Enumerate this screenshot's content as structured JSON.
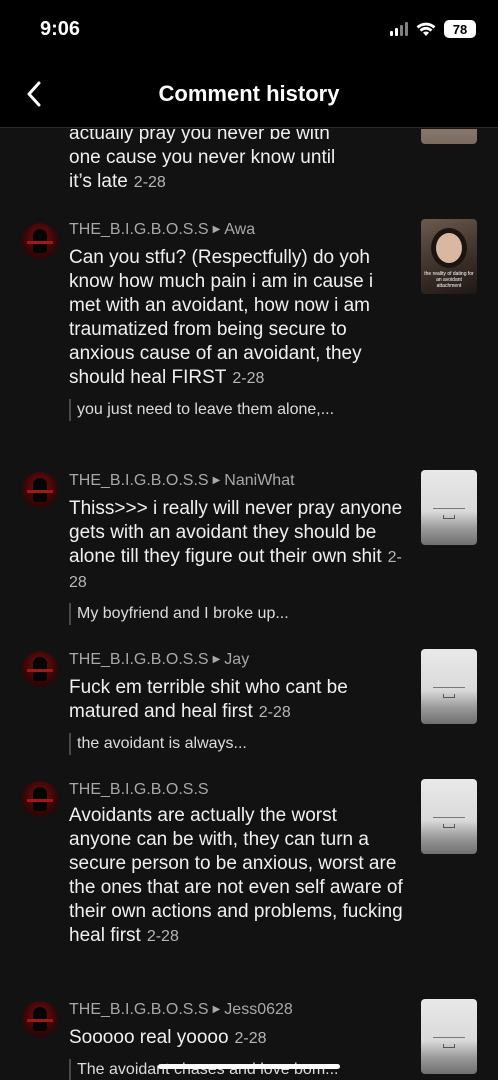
{
  "status_bar": {
    "time": "9:06",
    "battery": "78"
  },
  "header": {
    "title": "Comment history",
    "back_icon": "chevron-left-icon"
  },
  "partial_item": {
    "comment_lines": [
      "actually pray you never be with",
      "one cause you never know until",
      "it’s late"
    ],
    "date": "2-28"
  },
  "comments": [
    {
      "user": "THE_B.I.G.B.O.S.S",
      "target": "Awa",
      "text": "Can you stfu? (Respectfully) do yoh know how much pain i am in cause i met with an avoidant, how now i am traumatized from being secure to anxious cause of an avoidant, they should heal FIRST",
      "date": "2-28",
      "reply": "you just need to leave them alone,...",
      "thumb": "video",
      "thumb_caption": "the reality of dating for an avoidant attachment"
    },
    {
      "user": "THE_B.I.G.B.O.S.S",
      "target": "NaniWhat",
      "text": "Thiss>>> i really will never pray anyone gets with an avoidant they should be alone till they figure out their own shit",
      "date": "2-28",
      "reply": "My boyfriend and I broke up...",
      "thumb": "gray"
    },
    {
      "user": "THE_B.I.G.B.O.S.S",
      "target": "Jay",
      "text": "Fuck em terrible shit who cant be matured and heal first",
      "date": "2-28",
      "reply": "the avoidant is always...",
      "thumb": "gray"
    },
    {
      "user": "THE_B.I.G.B.O.S.S",
      "target": "",
      "text": "Avoidants are actually the worst anyone can be with, they can turn a secure person to be anxious, worst are the ones that are not even self aware of their own actions and problems, fucking heal first",
      "date": "2-28",
      "reply": "",
      "thumb": "gray"
    },
    {
      "user": "THE_B.I.G.B.O.S.S",
      "target": "Jess0628",
      "text": "Sooooo real yoooo",
      "date": "2-28",
      "reply": "The avoidant chases and love bom...",
      "thumb": "gray"
    }
  ]
}
